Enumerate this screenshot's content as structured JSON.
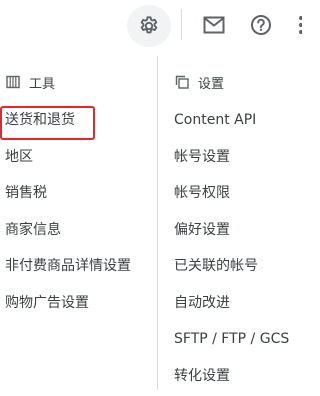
{
  "toolbar": {
    "settings_icon": "gear-icon",
    "mail_icon": "mail-icon",
    "help_icon": "help-icon",
    "more_icon": "more-icon"
  },
  "tools": {
    "heading": "工具",
    "icon": "tools-icon",
    "items": [
      {
        "label": "送货和退货"
      },
      {
        "label": "地区"
      },
      {
        "label": "销售税"
      },
      {
        "label": "商家信息"
      },
      {
        "label": "非付费商品详情设置"
      },
      {
        "label": "购物广告设置"
      }
    ]
  },
  "settings": {
    "heading": "设置",
    "icon": "settings-icon",
    "items": [
      {
        "label": "Content API"
      },
      {
        "label": "帐号设置"
      },
      {
        "label": "帐号权限"
      },
      {
        "label": "偏好设置"
      },
      {
        "label": "已关联的帐号"
      },
      {
        "label": "自动改进"
      },
      {
        "label": "SFTP / FTP / GCS"
      },
      {
        "label": "转化设置"
      }
    ]
  },
  "colors": {
    "highlight": "#e8262a",
    "text": "#3c4043",
    "active_bg": "#f1f3f4"
  }
}
